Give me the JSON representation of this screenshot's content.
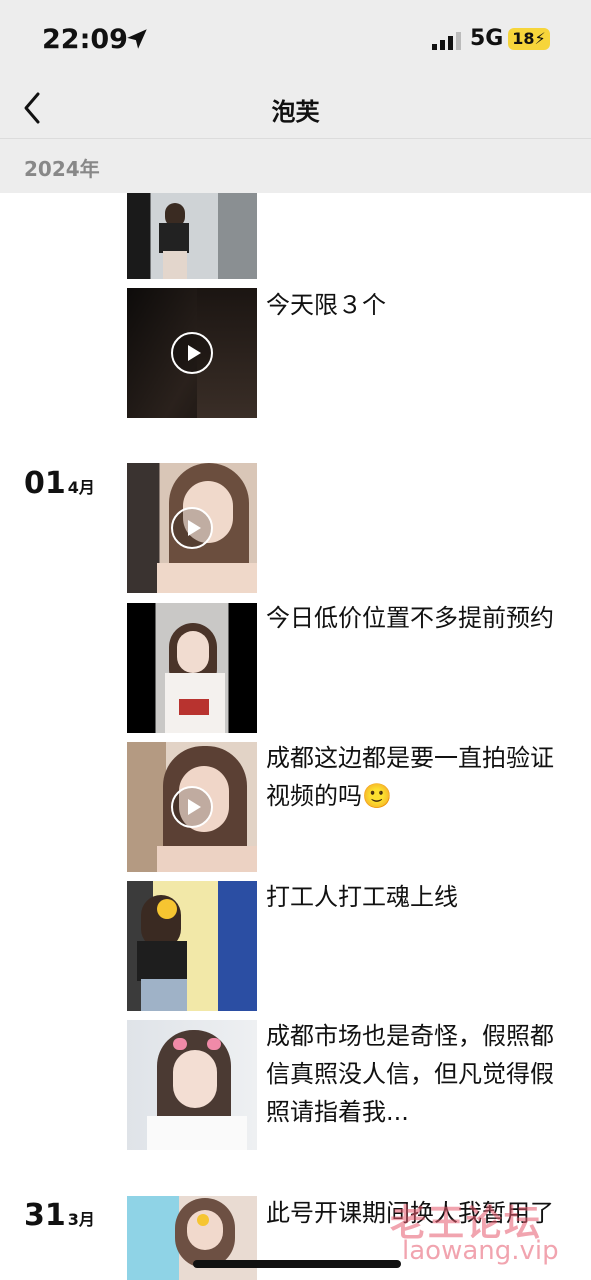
{
  "status": {
    "time": "22:09",
    "network": "5G",
    "battery": "18"
  },
  "header": {
    "title": "泡芙"
  },
  "year_label": "2024年",
  "posts": [
    {
      "text": ""
    },
    {
      "text": "今天限３个"
    },
    {
      "text": ""
    },
    {
      "text": "今日低价位置不多提前预约"
    },
    {
      "text": "成都这边都是要一直拍验证视频的吗🙂"
    },
    {
      "text": "打工人打工魂上线"
    },
    {
      "text": "成都市场也是奇怪，假照都信真照没人信，但凡觉得假照请指着我..."
    },
    {
      "text": "此号开课期间换人我暂用了"
    }
  ],
  "dates": [
    {
      "day": "01",
      "month": "4月"
    },
    {
      "day": "31",
      "month": "3月"
    }
  ],
  "watermark": {
    "brand": "老王论坛",
    "url": "laowang.vip"
  },
  "colors": {
    "bar": "#ededed",
    "text": "#111111",
    "watermark": "#e65a6e"
  }
}
